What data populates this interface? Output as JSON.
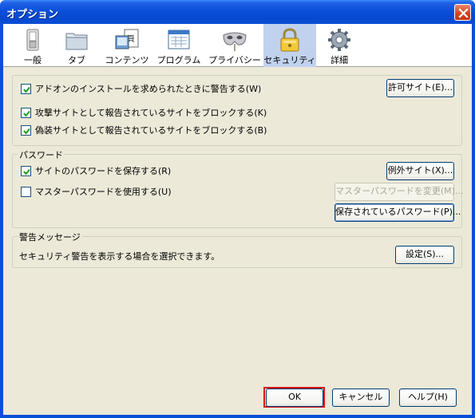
{
  "window": {
    "title": "オプション"
  },
  "toolbar": {
    "items": [
      {
        "label": "一般",
        "icon": "switch-icon"
      },
      {
        "label": "タブ",
        "icon": "folder-icon"
      },
      {
        "label": "コンテンツ",
        "icon": "content-icon"
      },
      {
        "label": "プログラム",
        "icon": "program-icon"
      },
      {
        "label": "プライバシー",
        "icon": "mask-icon"
      },
      {
        "label": "セキュリティ",
        "icon": "lock-icon",
        "selected": true
      },
      {
        "label": "詳細",
        "icon": "gear-icon"
      }
    ]
  },
  "addons": {
    "warn_label": "アドオンのインストールを求められたときに警告する(W)",
    "warn_checked": true,
    "exceptions_button": "許可サイト(E)...",
    "block_attack_label": "攻撃サイトとして報告されているサイトをブロックする(K)",
    "block_attack_checked": true,
    "block_forgery_label": "偽装サイトとして報告されているサイトをブロックする(B)",
    "block_forgery_checked": true
  },
  "passwords": {
    "title": "パスワード",
    "remember_label": "サイトのパスワードを保存する(R)",
    "remember_checked": true,
    "exceptions_button": "例外サイト(X)...",
    "master_label": "マスターパスワードを使用する(U)",
    "master_checked": false,
    "change_master_button": "マスターパスワードを変更(M)...",
    "saved_passwords_button": "保存されているパスワード(P)..."
  },
  "warnings": {
    "title": "警告メッセージ",
    "description": "セキュリティ警告を表示する場合を選択できます。",
    "settings_button": "設定(S)..."
  },
  "footer": {
    "ok": "OK",
    "cancel": "キャンセル",
    "help": "ヘルプ(H)"
  },
  "colors": {
    "titlebar": "#0a4fd8",
    "dialog_bg": "#ece9d8",
    "selected_tab": "#c1d2ee",
    "highlight": "#d81414"
  }
}
